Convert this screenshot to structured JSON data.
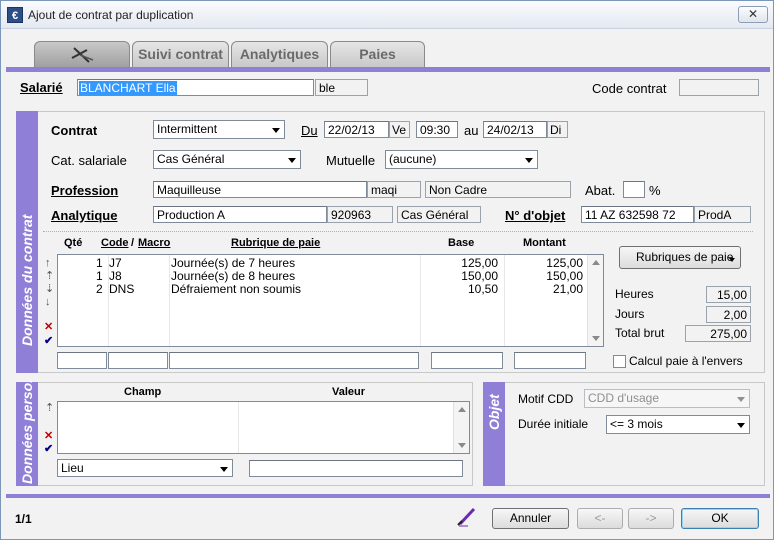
{
  "window": {
    "title": "Ajout de contrat par duplication",
    "close_glyph": "✕",
    "app_icon_glyph": "€"
  },
  "tabs": {
    "t2": "Suivi contrat",
    "t3": "Analytiques",
    "t4": "Paies"
  },
  "salarie": {
    "label": "Salarié",
    "name": "BLANCHART Ella",
    "code": "ble"
  },
  "code_contrat": {
    "label": "Code contrat",
    "value": ""
  },
  "donnees_contrat": {
    "side_label": "Données du contrat",
    "contrat_label": "Contrat",
    "contrat_value": "Intermittent",
    "du_label": "Du",
    "du_date": "22/02/13",
    "du_day": "Ve",
    "du_time": "09:30",
    "au_label": "au",
    "au_date": "24/02/13",
    "au_day": "Di",
    "cat_label": "Cat. salariale",
    "cat_value": "Cas Général",
    "mutuelle_label": "Mutuelle",
    "mutuelle_value": "(aucune)",
    "profession_label": "Profession",
    "profession_value": "Maquilleuse",
    "profession_code": "maqi",
    "profession_statut": "Non Cadre",
    "abat_label": "Abat.",
    "abat_value": "",
    "abat_unit": "%",
    "analytique_label": "Analytique",
    "analytique_value": "Production A",
    "analytique_code": "920963",
    "analytique_cat": "Cas Général",
    "objet_label": "N° d'objet",
    "objet_value": "11 AZ 632598 72",
    "objet_code": "ProdA"
  },
  "paie_grid": {
    "headers": {
      "qte": "Qté",
      "code": "Code",
      "sep": "/",
      "macro": "Macro",
      "rubrique": "Rubrique de paie",
      "base": "Base",
      "montant": "Montant"
    },
    "rows": [
      {
        "qte": "1",
        "code": "J7",
        "rubrique": "Journée(s) de 7 heures",
        "base": "125,00",
        "montant": "125,00"
      },
      {
        "qte": "1",
        "code": "J8",
        "rubrique": "Journée(s) de 8 heures",
        "base": "150,00",
        "montant": "150,00"
      },
      {
        "qte": "2",
        "code": "DNS",
        "rubrique": "Défraiement non soumis",
        "base": "10,50",
        "montant": "21,00"
      }
    ]
  },
  "rubriques_button": "Rubriques de paie",
  "totals": {
    "heures_label": "Heures",
    "heures": "15,00",
    "jours_label": "Jours",
    "jours": "2,00",
    "brut_label": "Total brut",
    "brut": "275,00"
  },
  "calcul_envers_label": "Calcul paie à l'envers",
  "donnees_perso": {
    "side_label": "Données perso.",
    "col_champ": "Champ",
    "col_valeur": "Valeur",
    "lieu_select": "Lieu",
    "lieu_value": ""
  },
  "objet": {
    "side_label": "Objet",
    "motif_label": "Motif CDD",
    "motif_value": "CDD d'usage",
    "duree_label": "Durée initiale",
    "duree_value": "<= 3 mois"
  },
  "footer": {
    "record_pos": "1/1",
    "annuler": "Annuler",
    "prev": "<-",
    "next": "->",
    "ok": "OK"
  },
  "colors": {
    "accent": "#8f7fd6",
    "selection": "#3399ff"
  }
}
